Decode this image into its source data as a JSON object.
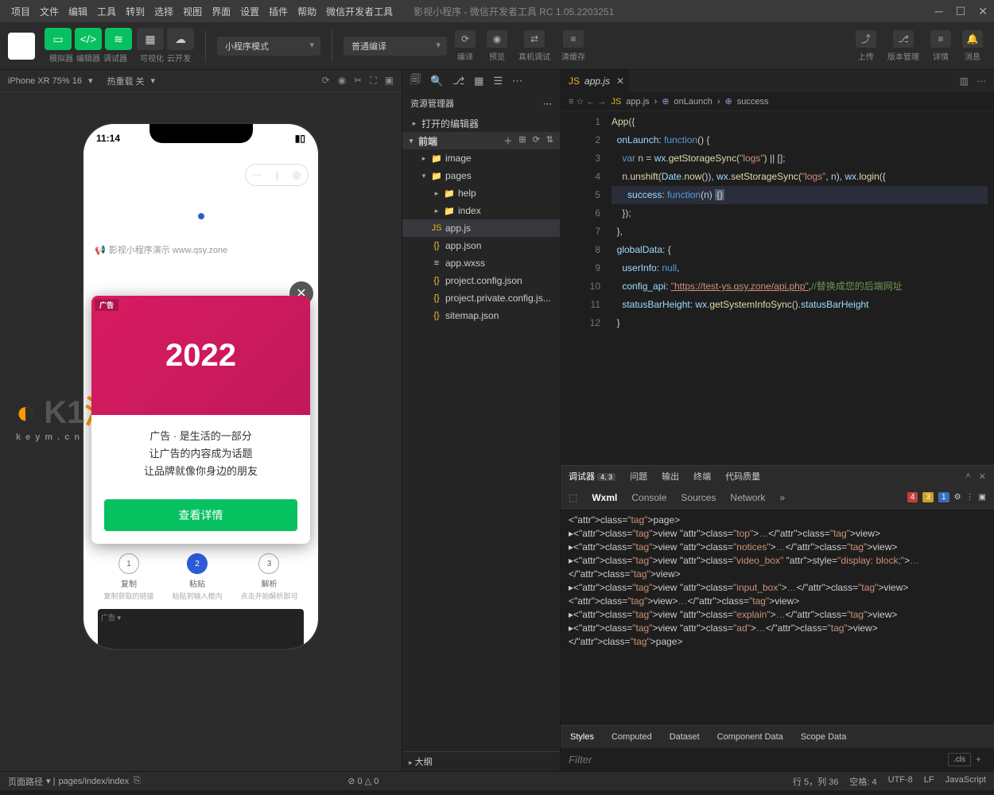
{
  "menu": [
    "项目",
    "文件",
    "编辑",
    "工具",
    "转到",
    "选择",
    "视图",
    "界面",
    "设置",
    "插件",
    "帮助",
    "微信开发者工具"
  ],
  "title": "影视小程序 - 微信开发者工具 RC 1.05.2203251",
  "toolbar": {
    "labels": [
      "模拟器",
      "编辑器",
      "调试器",
      "可视化",
      "云开发"
    ],
    "mode_select": "小程序模式",
    "compile_select": "普通编译",
    "actions": {
      "compile": "编译",
      "preview": "预览",
      "remote": "真机调试",
      "clear": "清缓存"
    },
    "right": {
      "upload": "上传",
      "version": "版本管理",
      "details": "详情",
      "notif": "消息"
    }
  },
  "sim": {
    "device": "iPhone XR 75% 16",
    "hot": "热重载 关",
    "time": "11:14",
    "notice": "影视小程序演示 www.qsy.zone",
    "ad_year": "2022",
    "ad_tag": "广告",
    "ad_lines": [
      "广告 · 是生活的一部分",
      "让广告的内容成为话题",
      "让品牌就像你身边的朋友"
    ],
    "ad_btn": "查看详情",
    "steps": [
      {
        "n": "1",
        "t": "复制",
        "s": "复制获取的链接"
      },
      {
        "n": "2",
        "t": "粘贴",
        "s": "粘贴到输入框内"
      },
      {
        "n": "3",
        "t": "解析",
        "s": "点击开始解析即可"
      }
    ]
  },
  "explorer": {
    "title": "资源管理器",
    "open_editors": "打开的编辑器",
    "root": "前端",
    "outline": "大纲",
    "tree": [
      {
        "icon": "📁",
        "name": "image",
        "ic": "ic-img",
        "chev": "▸",
        "ind": "indent1"
      },
      {
        "icon": "📁",
        "name": "pages",
        "ic": "ic-folder",
        "chev": "▾",
        "ind": "indent1"
      },
      {
        "icon": "📁",
        "name": "help",
        "ic": "",
        "chev": "▸",
        "ind": "indent2"
      },
      {
        "icon": "📁",
        "name": "index",
        "ic": "",
        "chev": "▸",
        "ind": "indent2"
      },
      {
        "icon": "JS",
        "name": "app.js",
        "ic": "ic-js",
        "sel": true,
        "ind": "indent1"
      },
      {
        "icon": "{}",
        "name": "app.json",
        "ic": "ic-json",
        "ind": "indent1"
      },
      {
        "icon": "≡",
        "name": "app.wxss",
        "ic": "",
        "ind": "indent1"
      },
      {
        "icon": "{}",
        "name": "project.config.json",
        "ic": "ic-json",
        "ind": "indent1"
      },
      {
        "icon": "{}",
        "name": "project.private.config.js...",
        "ic": "ic-json",
        "ind": "indent1"
      },
      {
        "icon": "{}",
        "name": "sitemap.json",
        "ic": "ic-json",
        "ind": "indent1"
      }
    ]
  },
  "editor": {
    "tab": "app.js",
    "crumbs": [
      "app.js",
      "onLaunch",
      "success"
    ],
    "lines": [
      {
        "n": "1",
        "html": "<span class='k-fn'>App</span>({"
      },
      {
        "n": "2",
        "html": "  <span class='k-prop'>onLaunch</span>: <span class='k-blue'>function</span>() {"
      },
      {
        "n": "3",
        "html": "    <span class='k-blue'>var</span> n = <span class='k-prop'>wx</span>.<span class='k-fn'>getStorageSync</span>(<span class='k-str'>\"logs\"</span>) || [];"
      },
      {
        "n": "4",
        "html": "    n.<span class='k-fn'>unshift</span>(<span class='k-prop'>Date</span>.<span class='k-fn'>now</span>()), <span class='k-prop'>wx</span>.<span class='k-fn'>setStorageSync</span>(<span class='k-str'>\"logs\"</span>, n), <span class='k-prop'>wx</span>.<span class='k-fn'>login</span>({"
      },
      {
        "n": "5",
        "hl": true,
        "html": "      <span class='k-prop'>success</span>: <span class='k-blue'>function</span>(<span class='k-prop'>n</span>) <span style='background:#515c6a;padding:0 2px;'>{}</span>"
      },
      {
        "n": "6",
        "html": "    });"
      },
      {
        "n": "7",
        "html": "  },"
      },
      {
        "n": "8",
        "html": "  <span class='k-prop'>globalData</span>: {"
      },
      {
        "n": "9",
        "html": "    <span class='k-prop'>userInfo</span>: <span class='k-null'>null</span>,"
      },
      {
        "n": "10",
        "html": "    <span class='k-prop'>config_api</span>: <span class='k-str' style='text-decoration:underline;'>\"https://test-ys.qsy.zone/api.php\"</span>,<span class='k-com'>//替换成您的后端网址</span>"
      },
      {
        "n": "11",
        "html": "    <span class='k-prop'>statusBarHeight</span>: <span class='k-prop'>wx</span>.<span class='k-fn'>getSystemInfoSync</span>().<span class='k-prop'>statusBarHeight</span>"
      },
      {
        "n": "12",
        "html": "  }"
      }
    ]
  },
  "debugger": {
    "tabs": [
      "调试器",
      "问题",
      "输出",
      "终端",
      "代码质量"
    ],
    "badge": "4, 3",
    "devtabs": [
      "Wxml",
      "Console",
      "Sources",
      "Network"
    ],
    "errors": {
      "e": "4",
      "w": "3",
      "i": "1"
    },
    "wxml": [
      "<page>",
      "▸<view class=\"top\">…</view>",
      "▸<view class=\"notices\">…</view>",
      "▸<view class=\"video_box\" style=\"display: block;\">…</view>",
      "▸<view class=\"input_box\">…</view>",
      " <view>…</view>",
      "▸<view class=\"explain\">…</view>",
      "▸<view class=\"ad\">…</view>",
      "</page>"
    ],
    "style_tabs": [
      "Styles",
      "Computed",
      "Dataset",
      "Component Data",
      "Scope Data"
    ],
    "filter": "Filter",
    "cls": ".cls"
  },
  "status": {
    "path_lbl": "页面路径",
    "path": "pages/index/index",
    "err": "⊘ 0 △ 0",
    "pos": "行 5，列 36",
    "spaces": "空格: 4",
    "enc": "UTF-8",
    "eol": "LF",
    "lang": "JavaScript"
  }
}
